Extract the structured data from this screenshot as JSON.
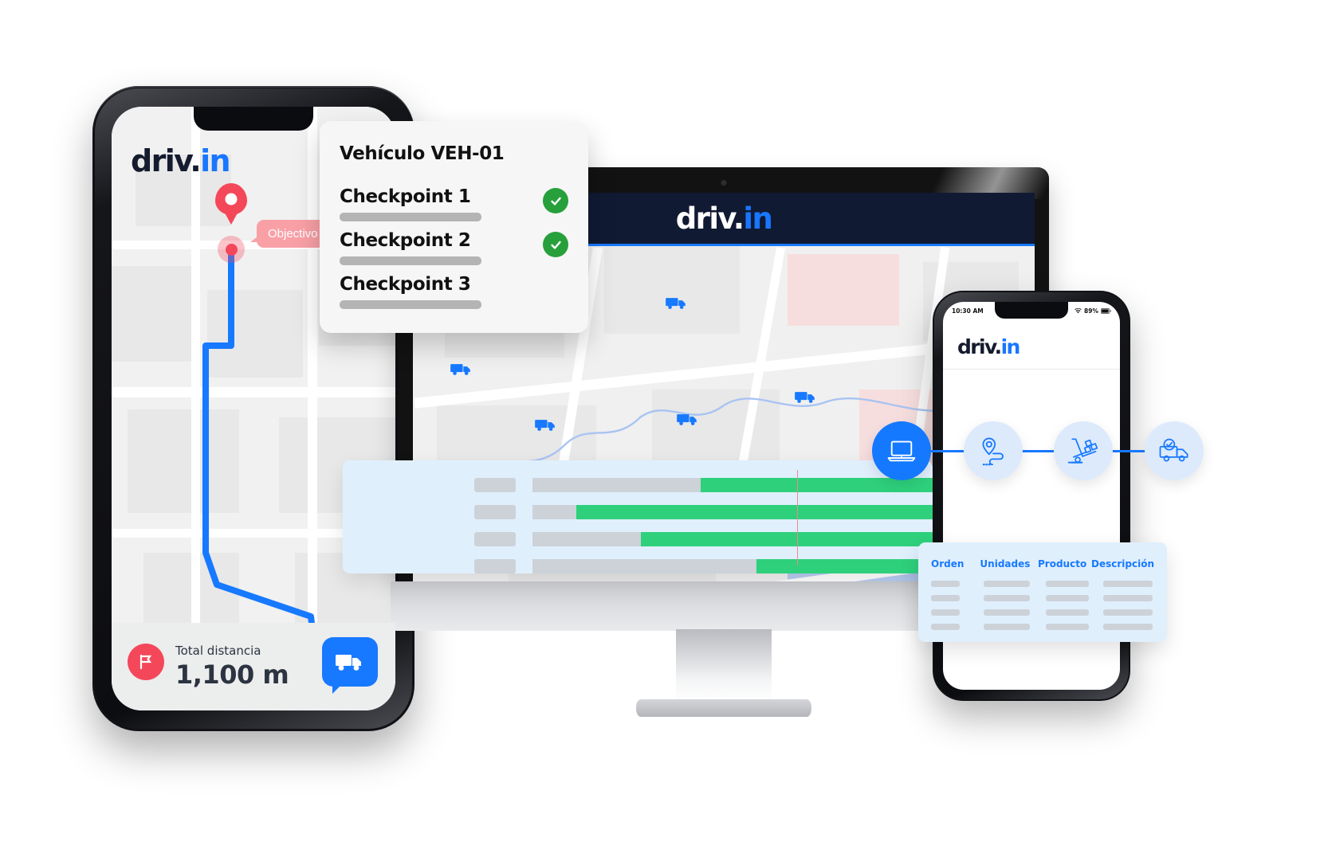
{
  "brand": {
    "name_dark": "driv.",
    "name_blue": "in",
    "accent": "#1779ff",
    "dark": "#151b2e"
  },
  "left_phone": {
    "logo_dark": "driv.",
    "logo_blue": "in",
    "map_callout": "Objectivo",
    "distance_label": "Total distancia",
    "distance_value": "1,100 m",
    "flag_icon": "flag-icon",
    "truck_button_icon": "truck-icon"
  },
  "checkpoint_card": {
    "title": "Vehículo VEH-01",
    "rows": [
      {
        "label": "Checkpoint 1",
        "done": true
      },
      {
        "label": "Checkpoint 2",
        "done": true
      },
      {
        "label": "Checkpoint 3",
        "done": false
      }
    ]
  },
  "monitor": {
    "logo_dark": "driv.",
    "logo_blue": "in",
    "header_bg": "#101a33",
    "accent_underline": "#1779ff",
    "map_truck_count": 5
  },
  "gantt": {
    "bg": "#e0effc",
    "bar_color": "#2ed07c",
    "track_color": "#ccd2d8",
    "now_line_color": "#f08a8a",
    "now_line_pct": 77,
    "rows": [
      {
        "start_pct": 42,
        "end_pct": 100
      },
      {
        "start_pct": 11,
        "end_pct": 100
      },
      {
        "start_pct": 27,
        "end_pct": 100
      },
      {
        "start_pct": 56,
        "end_pct": 100
      }
    ]
  },
  "right_phone": {
    "status_time": "10:30 AM",
    "status_battery": "89%",
    "status_wifi_icon": "wifi-icon",
    "logo_dark": "driv.",
    "logo_blue": "in",
    "flow_steps": [
      {
        "icon": "laptop-icon",
        "state": "active"
      },
      {
        "icon": "route-pin-icon",
        "state": "idle"
      },
      {
        "icon": "hand-truck-icon",
        "state": "idle"
      },
      {
        "icon": "delivered-truck-icon",
        "state": "idle"
      }
    ]
  },
  "order_table": {
    "columns": [
      "Orden",
      "Unidades",
      "Producto",
      "Descripción"
    ],
    "rows": [
      [
        "",
        "",
        "",
        ""
      ],
      [
        "",
        "",
        "",
        ""
      ],
      [
        "",
        "",
        "",
        ""
      ],
      [
        "",
        "",
        "",
        ""
      ]
    ]
  }
}
